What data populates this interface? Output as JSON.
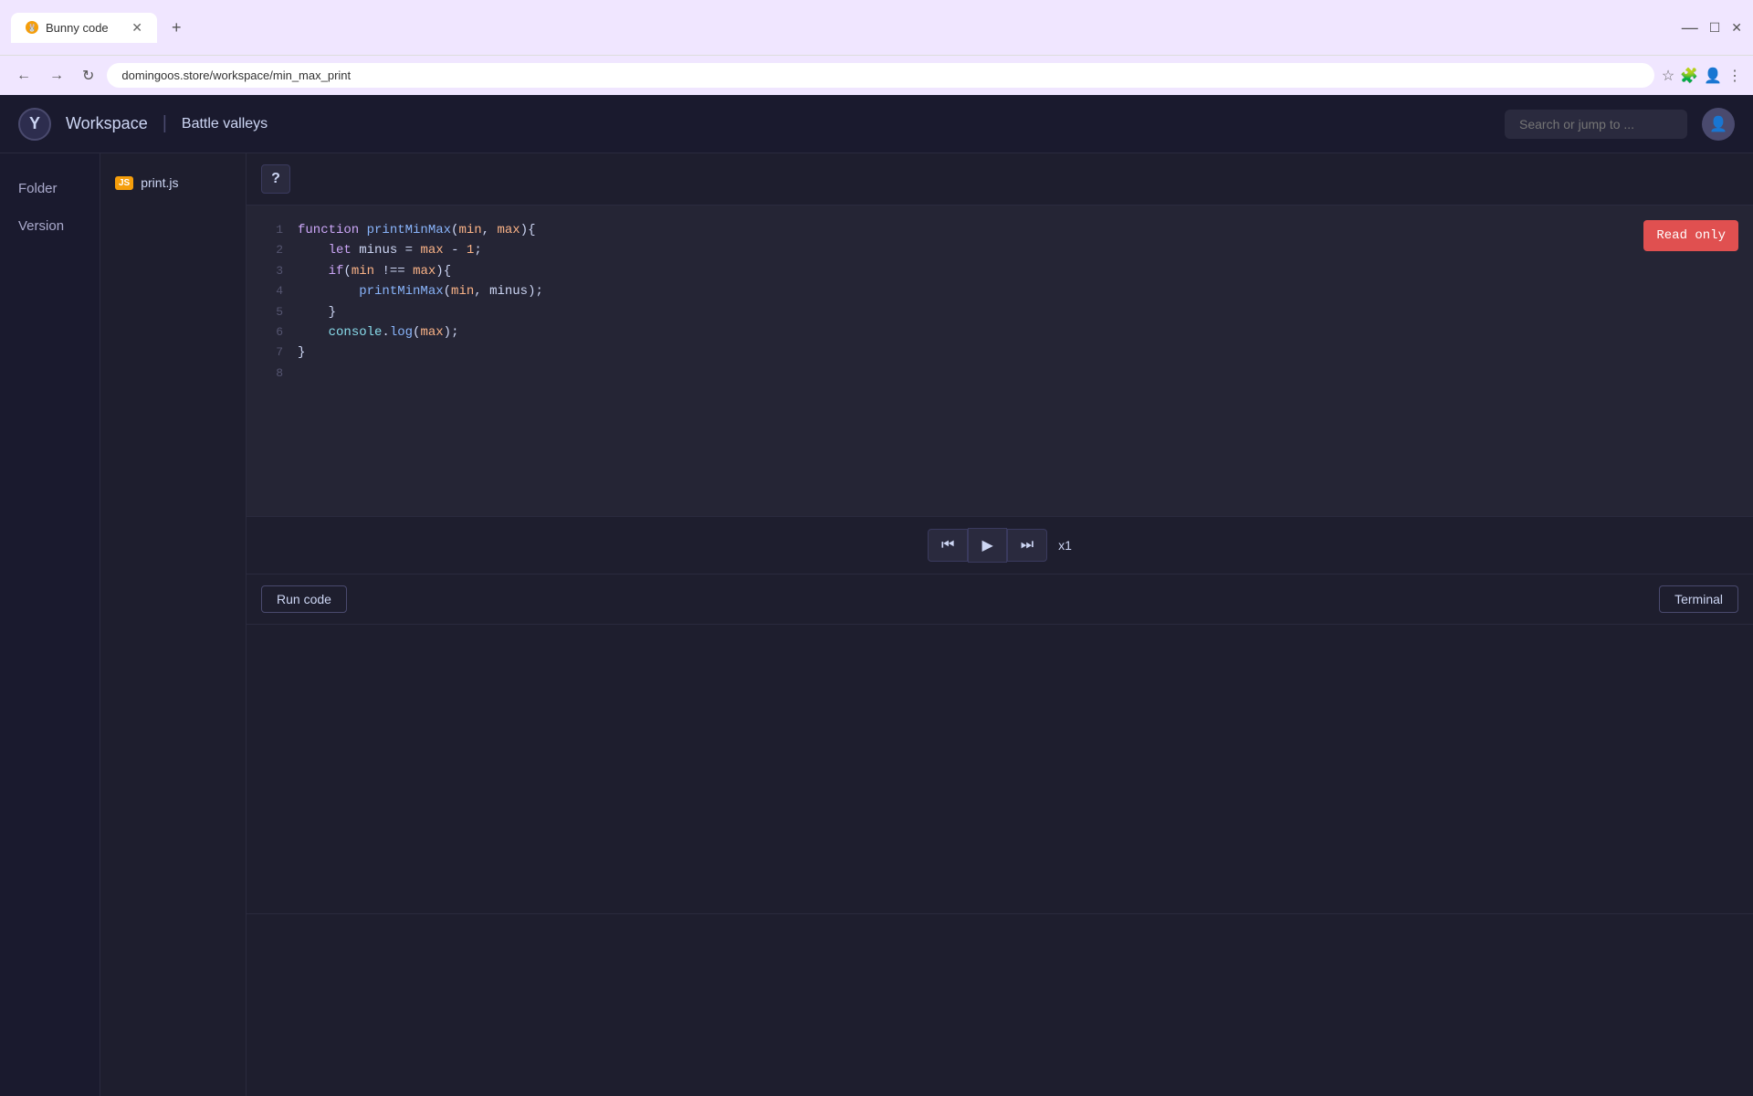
{
  "browser": {
    "tab_title": "Bunny code",
    "tab_favicon": "🐰",
    "address": "domingoos.store/workspace/min_max_print",
    "new_tab_label": "+"
  },
  "nav": {
    "logo_text": "Y",
    "workspace_label": "Workspace",
    "divider": "|",
    "battle_valleys_label": "Battle valleys",
    "search_placeholder": "Search or jump to ...",
    "user_icon": "👤"
  },
  "sidebar": {
    "items": [
      {
        "label": "Folder"
      },
      {
        "label": "Version"
      }
    ]
  },
  "file_panel": {
    "file_name": "print.js",
    "file_icon": "JS"
  },
  "editor": {
    "help_btn_label": "?",
    "read_only_label": "Read only",
    "lines": [
      {
        "num": "1",
        "content": "function printMinMax(min, max){"
      },
      {
        "num": "2",
        "content": "    let minus = max - 1;"
      },
      {
        "num": "3",
        "content": "    if(min !== max){"
      },
      {
        "num": "4",
        "content": "        printMinMax(min, minus);"
      },
      {
        "num": "5",
        "content": "    }"
      },
      {
        "num": "6",
        "content": "    console.log(max);"
      },
      {
        "num": "7",
        "content": "}"
      },
      {
        "num": "8",
        "content": ""
      }
    ]
  },
  "controls": {
    "rewind_label": "⏮",
    "play_label": "▶",
    "fast_forward_label": "⏭",
    "speed_label": "x1"
  },
  "output": {
    "run_btn_label": "Run code",
    "terminal_btn_label": "Terminal"
  }
}
